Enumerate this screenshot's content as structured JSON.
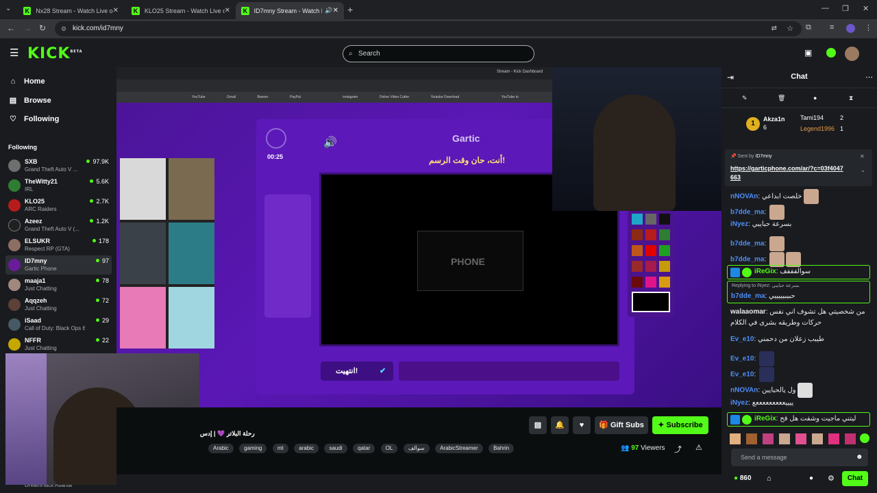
{
  "browser": {
    "tabs": [
      {
        "title": "Nx28 Stream - Watch Live on Ki"
      },
      {
        "title": "KLO25 Stream - Watch Live on K"
      },
      {
        "title": "ID7mny Stream - Watch Live"
      }
    ],
    "url": "kick.com/id7mny"
  },
  "header": {
    "logo": "KICK",
    "logo_badge": "BETA",
    "search_placeholder": "Search"
  },
  "sidebar": {
    "nav": [
      {
        "label": "Home",
        "icon": "home-icon"
      },
      {
        "label": "Browse",
        "icon": "browse-icon"
      },
      {
        "label": "Following",
        "icon": "heart-icon"
      }
    ],
    "following_heading": "Following",
    "channels": [
      {
        "name": "SXB",
        "category": "Grand Theft Auto V ...",
        "viewers": "97.9K"
      },
      {
        "name": "TheWitty21",
        "category": "IRL",
        "viewers": "5.6K"
      },
      {
        "name": "KLO25",
        "category": "ARC Raiders",
        "viewers": "2.7K"
      },
      {
        "name": "Azeez",
        "category": "Grand Theft Auto V (...",
        "viewers": "1.2K"
      },
      {
        "name": "ELSUKR",
        "category": "Respect RP (GTA)",
        "viewers": "178"
      },
      {
        "name": "ID7mny",
        "category": "Gartic Phone",
        "viewers": "97"
      },
      {
        "name": "maaja1",
        "category": "Just Chatting",
        "viewers": "78"
      },
      {
        "name": "Aqqzeh",
        "category": "Just Chatting",
        "viewers": "72"
      },
      {
        "name": "iSaad",
        "category": "Call of Duty: Black Ops 6",
        "viewers": "29"
      },
      {
        "name": "NFFR",
        "category": "Just Chatting",
        "viewers": "22"
      }
    ],
    "footer_text": "DreamHack Atlanta"
  },
  "stream_capture": {
    "inner_tab": "Stream - Kick Dashboard",
    "bookmarks": [
      "YouTube",
      "Gmail",
      "Banner",
      "PayPal",
      "instagram",
      "Online Video Cutter",
      "Youtube Download",
      "YouTube to"
    ],
    "timer": "00:25",
    "game_title": "Gartic",
    "prompt": "أنت، حان وقت الرسم!",
    "done_button": "انتهيت!",
    "logo_text": "PHONE"
  },
  "stream_info": {
    "title": "رحلة البلاتر 💜 | إدس",
    "tags": [
      "Arabic",
      "gaming",
      "mt",
      "arabic",
      "saudi",
      "qatar",
      "OL",
      "سوالف",
      "ArabicStreamer",
      "Bahrin"
    ],
    "viewers": "97",
    "viewers_label": "Viewers",
    "gift_label": "Gift Subs",
    "subscribe_label": "Subscribe"
  },
  "chat": {
    "title": "Chat",
    "leaderboard": [
      {
        "rank": "1",
        "name": "Akza1n",
        "count": "6"
      },
      {
        "name": "Tami194",
        "count": "2"
      },
      {
        "name": "Legend1996",
        "count": "1"
      }
    ],
    "pinned": {
      "sent_by_label": "Sent by",
      "sender": "ID7mny",
      "link": "https://garticphone.com/ar/?c=03f4047663"
    },
    "messages": [
      {
        "user": "nNOVAn",
        "text": "خلصت ابداعي",
        "color": "#4f8ef7"
      },
      {
        "user": "b7dde_ma",
        "text": "",
        "color": "#4f8ef7"
      },
      {
        "user": "iNyez",
        "text": "بسرعة حبايبي",
        "color": "#4f8ef7"
      },
      {
        "user": "b7dde_ma",
        "text": "",
        "color": "#4f8ef7"
      },
      {
        "user": "b7dde_ma",
        "text": "",
        "color": "#4f8ef7"
      },
      {
        "user": "iReGix",
        "text": "سوالفففف",
        "color": "#53fc18"
      },
      {
        "user": "b7dde_ma",
        "text": "حبيبيييييي",
        "color": "#4f8ef7",
        "reply_to": "Replying to iNyez:",
        "reply_text": "بسرعة حبايبي"
      },
      {
        "user": "walaaomar",
        "text": "من شخصيتي هل تشوف اني نفس",
        "text2": "حركات وطريقه بشرى في الكلام",
        "color": "#e8eaed"
      },
      {
        "user": "Ev_e10",
        "text": "طيبب زعلان من دحمني",
        "color": "#4f8ef7"
      },
      {
        "user": "Ev_e10",
        "text": "",
        "color": "#4f8ef7"
      },
      {
        "user": "Ev_e10",
        "text": "",
        "color": "#4f8ef7"
      },
      {
        "user": "nNOVAn",
        "text": "ول يالحبايبن",
        "color": "#4f8ef7"
      },
      {
        "user": "iNyez",
        "text": "ييييعععععععععع",
        "color": "#4f8ef7"
      },
      {
        "user": "iReGix",
        "text": "ليتني ماجيت وشفت هل قح",
        "color": "#53fc18"
      }
    ],
    "input_placeholder": "Send a message",
    "points": "860",
    "send_label": "Chat"
  },
  "colors": {
    "accent": "#53fc18",
    "bg": "#0b0e0f",
    "panel": "#191b1f",
    "video_purple": "#4a1496"
  }
}
